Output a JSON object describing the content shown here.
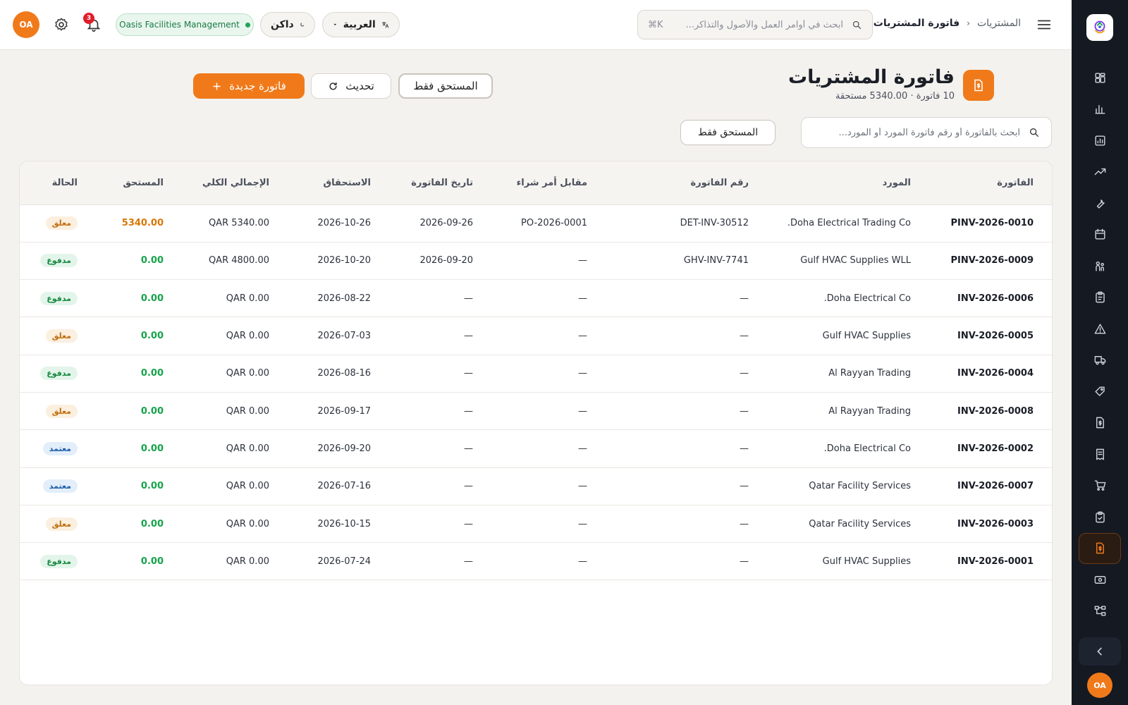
{
  "topbar": {
    "breadcrumb_parent": "المشتريات",
    "breadcrumb_current": "فاتورة المشتريات",
    "search_placeholder": "ابحث في أوامر العمل والأصول والتذاكر...",
    "search_shortcut": "⌘K",
    "language": "العربية",
    "theme": "داكن",
    "organization": "Oasis Facilities Management",
    "notification_count": "3",
    "avatar_initials": "OA"
  },
  "sidebar": {
    "avatar_initials": "OA",
    "items": [
      {
        "icon": "dashboard-icon"
      },
      {
        "icon": "bar-chart-icon"
      },
      {
        "icon": "report-icon"
      },
      {
        "icon": "trend-icon"
      },
      {
        "icon": "wrench-icon"
      },
      {
        "icon": "calendar-icon"
      },
      {
        "icon": "team-icon"
      },
      {
        "icon": "clipboard-icon"
      },
      {
        "icon": "warning-icon"
      },
      {
        "icon": "truck-icon"
      },
      {
        "icon": "tag-icon"
      },
      {
        "icon": "invoice-icon"
      },
      {
        "icon": "receipt-icon"
      },
      {
        "icon": "cart-icon"
      },
      {
        "icon": "clipboard-check-icon"
      },
      {
        "icon": "purchase-invoice-icon",
        "active": true
      },
      {
        "icon": "cash-icon"
      },
      {
        "icon": "workflow-icon"
      }
    ]
  },
  "page": {
    "title": "فاتورة المشتريات",
    "subtitle": "10 فاتورة · 5340.00 مستحقة",
    "due_only_label": "المستحق فقط",
    "refresh_label": "تحديث",
    "new_invoice_label": "فاتورة جديدة",
    "search_placeholder": "ابحث بالفاتورة أو رقم فاتورة المورد أو المورد...",
    "filter_due_label": "المستحق فقط"
  },
  "table": {
    "headers": [
      "الفاتورة",
      "المورد",
      "رقم الفاتورة",
      "مقابل أمر شراء",
      "تاريخ الفاتورة",
      "الاستحقاق",
      "الإجمالي الكلي",
      "المستحق",
      "الحالة"
    ],
    "rows": [
      {
        "invoice": "PINV-2026-0010",
        "supplier": "Doha Electrical Trading Co.",
        "supplier_invoice": "DET-INV-30512",
        "po": "PO-2026-0001",
        "invoice_date": "2026-09-26",
        "due_date": "2026-10-26",
        "total": "QAR 5340.00",
        "due": "5340.00",
        "status": "معلق",
        "status_kind": "pending",
        "action": "pay"
      },
      {
        "invoice": "PINV-2026-0009",
        "supplier": "Gulf HVAC Supplies WLL",
        "supplier_invoice": "GHV-INV-7741",
        "po": "—",
        "invoice_date": "2026-09-20",
        "due_date": "2026-10-20",
        "total": "QAR 4800.00",
        "due": "0.00",
        "status": "مدفوع",
        "status_kind": "paid",
        "action": "edit-muted"
      },
      {
        "invoice": "INV-2026-0006",
        "supplier": "Doha Electrical Co.",
        "supplier_invoice": "—",
        "po": "—",
        "invoice_date": "—",
        "due_date": "2026-08-22",
        "total": "QAR 0.00",
        "due": "0.00",
        "status": "مدفوع",
        "status_kind": "paid",
        "action": "edit-muted"
      },
      {
        "invoice": "INV-2026-0005",
        "supplier": "Gulf HVAC Supplies",
        "supplier_invoice": "—",
        "po": "—",
        "invoice_date": "—",
        "due_date": "2026-07-03",
        "total": "QAR 0.00",
        "due": "0.00",
        "status": "معلق",
        "status_kind": "pending",
        "action": "approve"
      },
      {
        "invoice": "INV-2026-0004",
        "supplier": "Al Rayyan Trading",
        "supplier_invoice": "—",
        "po": "—",
        "invoice_date": "—",
        "due_date": "2026-08-16",
        "total": "QAR 0.00",
        "due": "0.00",
        "status": "مدفوع",
        "status_kind": "paid",
        "action": "edit-muted"
      },
      {
        "invoice": "INV-2026-0008",
        "supplier": "Al Rayyan Trading",
        "supplier_invoice": "—",
        "po": "—",
        "invoice_date": "—",
        "due_date": "2026-09-17",
        "total": "QAR 0.00",
        "due": "0.00",
        "status": "معلق",
        "status_kind": "pending",
        "action": "approve"
      },
      {
        "invoice": "INV-2026-0002",
        "supplier": "Doha Electrical Co.",
        "supplier_invoice": "—",
        "po": "—",
        "invoice_date": "—",
        "due_date": "2026-09-20",
        "total": "QAR 0.00",
        "due": "0.00",
        "status": "معتمد",
        "status_kind": "approved",
        "action": "edit"
      },
      {
        "invoice": "INV-2026-0007",
        "supplier": "Qatar Facility Services",
        "supplier_invoice": "—",
        "po": "—",
        "invoice_date": "—",
        "due_date": "2026-07-16",
        "total": "QAR 0.00",
        "due": "0.00",
        "status": "معتمد",
        "status_kind": "approved",
        "action": "edit"
      },
      {
        "invoice": "INV-2026-0003",
        "supplier": "Qatar Facility Services",
        "supplier_invoice": "—",
        "po": "—",
        "invoice_date": "—",
        "due_date": "2026-10-15",
        "total": "QAR 0.00",
        "due": "0.00",
        "status": "معلق",
        "status_kind": "pending",
        "action": "approve"
      },
      {
        "invoice": "INV-2026-0001",
        "supplier": "Gulf HVAC Supplies",
        "supplier_invoice": "—",
        "po": "—",
        "invoice_date": "—",
        "due_date": "2026-07-24",
        "total": "QAR 0.00",
        "due": "0.00",
        "status": "مدفوع",
        "status_kind": "paid",
        "action": "edit-muted"
      }
    ]
  },
  "colors": {
    "accent": "#f07a1a",
    "sidebar_bg": "#151922",
    "paid": "#16893f",
    "pending": "#c26d0c",
    "approved": "#1f5ea8"
  }
}
